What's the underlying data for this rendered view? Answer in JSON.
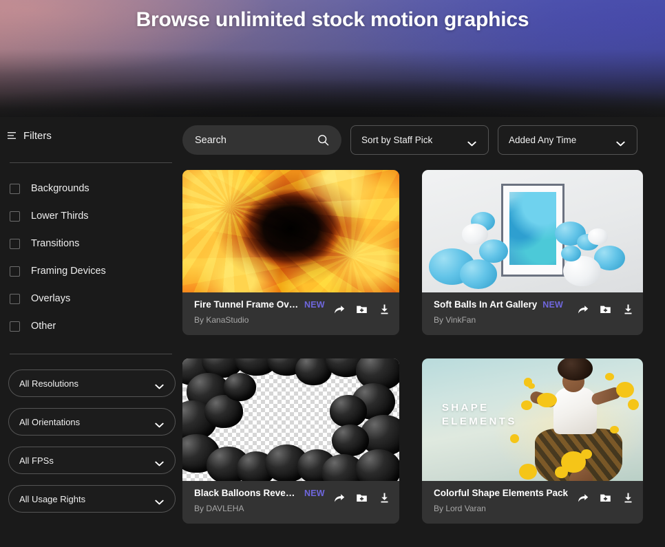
{
  "hero": {
    "title": "Browse unlimited stock motion graphics"
  },
  "sidebar": {
    "filters_label": "Filters",
    "filter_icon": "filter-lines-icon",
    "categories": [
      {
        "label": "Backgrounds",
        "checked": false
      },
      {
        "label": "Lower Thirds",
        "checked": false
      },
      {
        "label": "Transitions",
        "checked": false
      },
      {
        "label": "Framing Devices",
        "checked": false
      },
      {
        "label": "Overlays",
        "checked": false
      },
      {
        "label": "Other",
        "checked": false
      }
    ],
    "selects": [
      {
        "label": "All Resolutions",
        "icon": "chevron-down-icon"
      },
      {
        "label": "All Orientations",
        "icon": "chevron-down-icon"
      },
      {
        "label": "All FPSs",
        "icon": "chevron-down-icon"
      },
      {
        "label": "All Usage Rights",
        "icon": "chevron-down-icon"
      }
    ]
  },
  "toolbar": {
    "search": {
      "value": "",
      "placeholder": "Search",
      "icon": "search-icon"
    },
    "sort": {
      "label": "Sort by Staff Pick",
      "icon": "chevron-down-icon"
    },
    "date": {
      "label": "Added Any Time",
      "icon": "chevron-down-icon"
    }
  },
  "cards": [
    {
      "title": "Fire Tunnel Frame Overl...",
      "badge": "NEW",
      "author": "By KanaStudio",
      "actions": [
        "share-icon",
        "add-to-folder-icon",
        "download-icon"
      ]
    },
    {
      "title": "Soft Balls In Art Gallery",
      "badge": "NEW",
      "author": "By VinkFan",
      "actions": [
        "share-icon",
        "add-to-folder-icon",
        "download-icon"
      ]
    },
    {
      "title": "Black Balloons Reveal F...",
      "badge": "NEW",
      "author": "By DAVLEHA",
      "actions": [
        "share-icon",
        "add-to-folder-icon",
        "download-icon"
      ]
    },
    {
      "title": "Colorful Shape Elements Pack",
      "badge": "",
      "author": "By Lord Varan",
      "actions": [
        "share-icon",
        "add-to-folder-icon",
        "download-icon"
      ]
    }
  ],
  "thumbnails": {
    "shape_elements_overlay_line1": "SHAPE",
    "shape_elements_overlay_line2": "ELEMENTS"
  },
  "colors": {
    "page_background": "#1a1a1a",
    "card_footer": "#333333",
    "badge_new": "#6f67dd",
    "search_background": "#333333",
    "border": "#555555",
    "muted_text": "#a8a8a8"
  }
}
